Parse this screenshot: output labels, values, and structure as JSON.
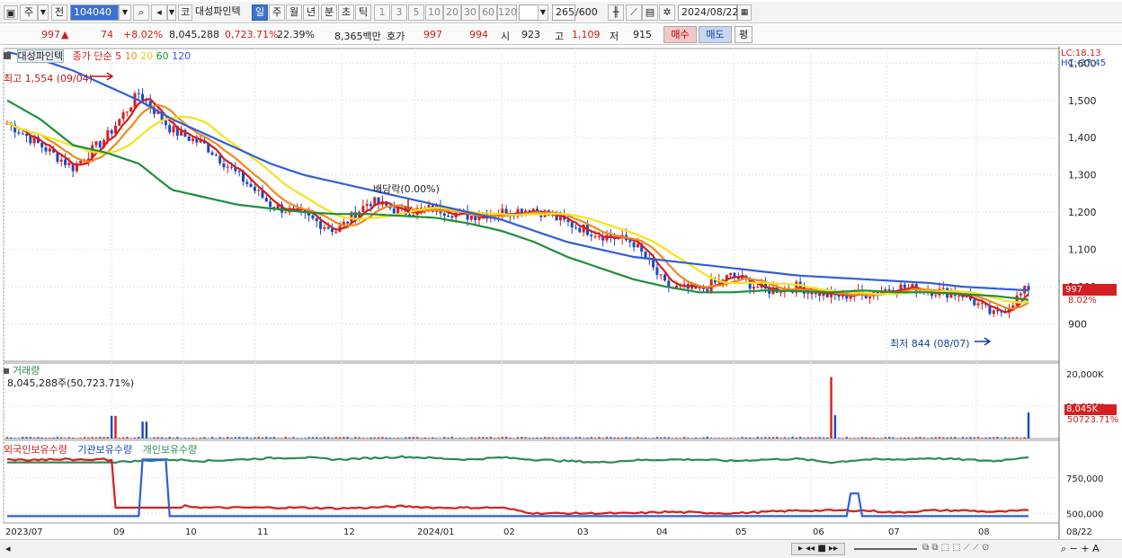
{
  "toolbar": {
    "type_label": "주",
    "prev_label": "전",
    "code_value": "104040",
    "stock_name": "대성파인텍",
    "mode_label": "코",
    "periods": [
      "일",
      "주",
      "월",
      "년",
      "분",
      "초",
      "틱"
    ],
    "intervals": [
      "1",
      "3",
      "5",
      "10",
      "20",
      "30",
      "60",
      "120"
    ],
    "count_value": "265",
    "count_total": "/600",
    "date_value": "2024/08/22"
  },
  "quote": {
    "price": "997",
    "change": "74",
    "change_pct": "+8.02%",
    "volume": "8,045,288",
    "volume_ratio": "0,723.71%",
    "turnover": "22.39%",
    "amount": "8,365백만",
    "hoga_label": "호가",
    "ask": "997",
    "bid": "994",
    "open_label": "시",
    "open": "923",
    "high_label": "고",
    "high": "1,109",
    "low_label": "저",
    "low": "915",
    "buy_label": "매수",
    "sell_label": "매도",
    "eval_label": "평"
  },
  "price_panel": {
    "name": "대성파인텍",
    "ma_label": "종가 단순",
    "ma_periods": [
      "5",
      "10",
      "20",
      "60",
      "120"
    ],
    "ma_colors": [
      "#d61f1f",
      "#f08a1c",
      "#f5e31a",
      "#1e8f3a",
      "#2f5fd8"
    ],
    "lc": "LC:18.13",
    "hc": "HC:-37.45",
    "high_marker": "최고 1,554 (09/04)",
    "low_marker": "최저 844 (08/07)",
    "dividend_marker": "배당락(0.00%)",
    "last_price_tag": "997",
    "last_pct_tag": "8.02%",
    "y_ticks": [
      "1,600",
      "1,500",
      "1,400",
      "1,300",
      "1,200",
      "1,100",
      "1,000",
      "900"
    ]
  },
  "volume_panel": {
    "title": "거래량",
    "summary": "8,045,288주(50,723.71%)",
    "y_ticks": [
      "20,000K",
      "10,000K"
    ],
    "last_tag": "8,045K",
    "last_pct": "50723.71%"
  },
  "holding_panel": {
    "legend": [
      "외국인보유수량",
      "기관보유수량",
      "개인보유수량"
    ],
    "colors": [
      "#d61f1f",
      "#2f5fd8",
      "#2e8a56"
    ],
    "y_ticks": [
      "750,000",
      "500,000"
    ]
  },
  "x_axis": [
    "2023/07",
    "09",
    "10",
    "11",
    "12",
    "2024/01",
    "02",
    "03",
    "04",
    "05",
    "06",
    "07",
    "08"
  ],
  "x_right": "08/22",
  "chart_data": {
    "type": "candlestick",
    "series": [
      {
        "name": "대성파인텍",
        "close": [
          1440,
          1380,
          1320,
          1400,
          1520,
          1420,
          1380,
          1300,
          1220,
          1190,
          1150,
          1230,
          1200,
          1210,
          1190,
          1200,
          1210,
          1170,
          1140,
          1120,
          1000,
          990,
          1030,
          990,
          1000,
          975,
          980,
          1000,
          990,
          980,
          920,
          997
        ]
      },
      {
        "name": "5",
        "close": [
          1450,
          1390,
          1330,
          1390,
          1480,
          1420,
          1370,
          1310,
          1230,
          1190,
          1160,
          1220,
          1205,
          1205,
          1195,
          1200,
          1205,
          1170,
          1140,
          1120,
          1010,
          995,
          1025,
          990,
          1000,
          978,
          985,
          995,
          990,
          978,
          905,
          960
        ]
      },
      {
        "name": "60",
        "values": [
          1500,
          1450,
          1380,
          1360,
          1330,
          1260,
          1240,
          1220,
          1210,
          1200,
          1195,
          1195,
          1190,
          1185,
          1170,
          1150,
          1120,
          1080,
          1050,
          1020,
          1000,
          985,
          985,
          990,
          988,
          985,
          990,
          985,
          985,
          980,
          975,
          965
        ]
      },
      {
        "name": "120",
        "values": [
          1630,
          1610,
          1580,
          1540,
          1500,
          1450,
          1410,
          1370,
          1330,
          1300,
          1280,
          1260,
          1240,
          1220,
          1200,
          1180,
          1150,
          1120,
          1100,
          1080,
          1070,
          1060,
          1050,
          1040,
          1030,
          1025,
          1020,
          1015,
          1010,
          1000,
          995,
          990
        ]
      }
    ],
    "volume_spikes": [
      {
        "x": "09",
        "value": "7,000K"
      },
      {
        "x": "06",
        "value": "19,000K"
      },
      {
        "x": "08/22",
        "value": "8,045K"
      }
    ]
  }
}
